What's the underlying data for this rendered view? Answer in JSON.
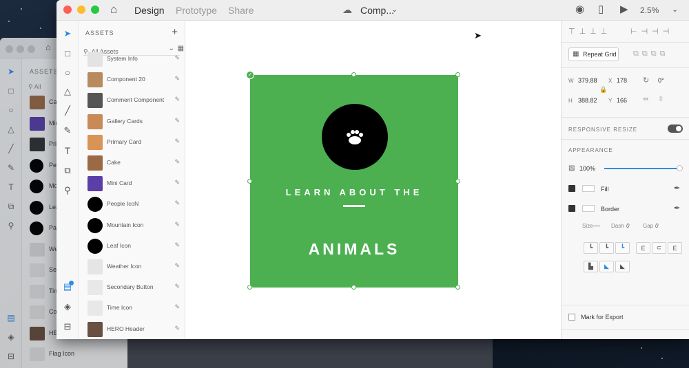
{
  "app": {
    "tabs": [
      "Design",
      "Prototype",
      "Share"
    ],
    "active_tab": "Design",
    "doc_title": "Comp...",
    "zoom": "2.5%"
  },
  "assets": {
    "header": "ASSETS",
    "search_placeholder": "All Assets",
    "items": [
      {
        "label": "System Info",
        "thumb": "#e3e3e3"
      },
      {
        "label": "Component 20",
        "thumb": "#b88a5e"
      },
      {
        "label": "Comment Component",
        "thumb": "#555555"
      },
      {
        "label": "Gallery Cards",
        "thumb": "#c98a55"
      },
      {
        "label": "Primary Card",
        "thumb": "#d99455"
      },
      {
        "label": "Cake",
        "thumb": "#9a6a44"
      },
      {
        "label": "Mini Card",
        "thumb": "#5b3ea8"
      },
      {
        "label": "People IcoN",
        "thumb": "#000000"
      },
      {
        "label": "Mountain Icon",
        "thumb": "#000000"
      },
      {
        "label": "Leaf Icon",
        "thumb": "#000000"
      },
      {
        "label": "Weather Icon",
        "thumb": "#e5e5e5"
      },
      {
        "label": "Secondary Button",
        "thumb": "#e8e8e8"
      },
      {
        "label": "Time Icon",
        "thumb": "#e8e8e8"
      },
      {
        "label": "HERO Header",
        "thumb": "#6a5040"
      }
    ]
  },
  "back_window": {
    "header": "ASSETS",
    "search": "All",
    "items": [
      {
        "label": "Ca",
        "thumb": "#9a6a44"
      },
      {
        "label": "Min",
        "thumb": "#5b3ea8"
      },
      {
        "label": "Prim",
        "thumb": "#333333"
      },
      {
        "label": "Peo",
        "thumb": "#000000"
      },
      {
        "label": "Mo",
        "thumb": "#000000"
      },
      {
        "label": "Lea",
        "thumb": "#000000"
      },
      {
        "label": "Pa",
        "thumb": "#000000"
      },
      {
        "label": "Weat",
        "thumb": "#dddddd"
      },
      {
        "label": "Seco",
        "thumb": "#e5e5e5"
      },
      {
        "label": "Tim",
        "thumb": "#e5e5e5"
      },
      {
        "label": "Co",
        "thumb": "#e5e5e5"
      },
      {
        "label": "HER",
        "thumb": "#6a5040"
      },
      {
        "label": "Flag Icon",
        "thumb": "#e5e5e5"
      }
    ]
  },
  "artboard": {
    "line1": "LEARN ABOUT THE",
    "line2": "ANIMALS",
    "color": "#4caf50"
  },
  "inspector": {
    "repeat_grid": "Repeat Grid",
    "w_label": "W",
    "w": "379.88",
    "h_label": "H",
    "h": "388.82",
    "x_label": "X",
    "x": "178",
    "y_label": "Y",
    "y": "166",
    "rotation": "0°",
    "responsive_resize": "RESPONSIVE RESIZE",
    "appearance": "APPEARANCE",
    "opacity": "100%",
    "fill": "Fill",
    "border": "Border",
    "size_label": "Size",
    "dash_label": "Dash",
    "dash": "0",
    "gap_label": "Gap",
    "gap": "0",
    "export": "Mark for Export"
  },
  "colors": {
    "accent": "#2d8ce6",
    "artboard_green": "#4caf50"
  }
}
